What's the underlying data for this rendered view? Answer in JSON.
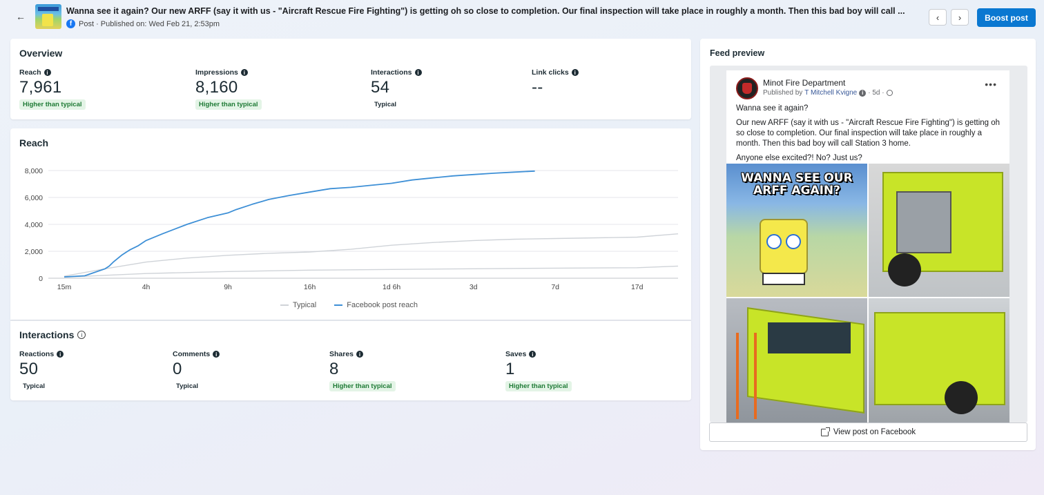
{
  "header": {
    "back_icon": "arrow-left-icon",
    "post_title": "Wanna see it again? Our new ARFF (say it with us - \"Aircraft Rescue Fire Fighting\") is getting oh so close to completion. Our final inspection will take place in roughly a month. Then this bad boy will call ...",
    "meta": "Post · Published on: Wed Feb 21, 2:53pm",
    "prev_icon": "chevron-left-icon",
    "next_icon": "chevron-right-icon",
    "boost_label": "Boost post",
    "boost_color": "#0a78d1"
  },
  "overview": {
    "title": "Overview",
    "metrics": [
      {
        "label": "Reach",
        "value": "7,961",
        "badge": "Higher than typical",
        "badge_type": "green"
      },
      {
        "label": "Impressions",
        "value": "8,160",
        "badge": "Higher than typical",
        "badge_type": "green"
      },
      {
        "label": "Interactions",
        "value": "54",
        "badge": "Typical",
        "badge_type": "plain"
      },
      {
        "label": "Link clicks",
        "value": "--",
        "badge": "",
        "badge_type": "none"
      }
    ]
  },
  "reach": {
    "title": "Reach",
    "legend": [
      "Typical",
      "Facebook post reach"
    ]
  },
  "chart_data": {
    "type": "line",
    "title": "Reach",
    "xlabel": "",
    "ylabel": "",
    "x_ticks": [
      "15m",
      "4h",
      "9h",
      "16h",
      "1d 6h",
      "3d",
      "7d",
      "17d"
    ],
    "y_ticks": [
      "0",
      "2,000",
      "4,000",
      "6,000",
      "8,000"
    ],
    "ylim": [
      0,
      8000
    ],
    "grid": true,
    "legend_position": "bottom",
    "series": [
      {
        "name": "Facebook post reach",
        "color": "#3d8fd6",
        "x": [
          0,
          0.25,
          0.5,
          0.55,
          0.6,
          0.7,
          0.75,
          0.8,
          0.9,
          1,
          1.2,
          1.5,
          1.75,
          2,
          2.1,
          2.3,
          2.5,
          2.75,
          3,
          3.25,
          3.5,
          3.75,
          4,
          4.25,
          4.5,
          4.75,
          5,
          5.25,
          5.5,
          5.75
        ],
        "values": [
          100,
          180,
          700,
          900,
          1200,
          1700,
          1900,
          2100,
          2400,
          2800,
          3300,
          4000,
          4500,
          4850,
          5100,
          5500,
          5850,
          6150,
          6400,
          6650,
          6750,
          6900,
          7050,
          7300,
          7450,
          7600,
          7700,
          7800,
          7880,
          7961
        ]
      },
      {
        "name": "Typical",
        "color": "#cfd3d8",
        "x": [
          0,
          0.5,
          1,
          1.5,
          2,
          2.5,
          3,
          3.5,
          4,
          4.5,
          5,
          5.5,
          6,
          6.5,
          7,
          7.5
        ],
        "values": [
          150,
          700,
          1200,
          1500,
          1700,
          1850,
          1950,
          2150,
          2450,
          2650,
          2800,
          2900,
          2950,
          3000,
          3050,
          3300
        ]
      },
      {
        "name": "Typical (lower band)",
        "color": "#cfd3d8",
        "x": [
          0,
          1,
          2,
          3,
          4,
          5,
          6,
          7,
          7.5
        ],
        "values": [
          80,
          350,
          500,
          600,
          650,
          700,
          750,
          780,
          900
        ]
      }
    ]
  },
  "interactions": {
    "title": "Interactions",
    "info_icon": "info-circle-icon",
    "metrics": [
      {
        "label": "Reactions",
        "value": "50",
        "badge": "Typical",
        "badge_type": "plain"
      },
      {
        "label": "Comments",
        "value": "0",
        "badge": "Typical",
        "badge_type": "plain"
      },
      {
        "label": "Shares",
        "value": "8",
        "badge": "Higher than typical",
        "badge_type": "green"
      },
      {
        "label": "Saves",
        "value": "1",
        "badge": "Higher than typical",
        "badge_type": "green"
      }
    ]
  },
  "feed_preview": {
    "title": "Feed preview",
    "page_name": "Minot Fire Department",
    "published_by_prefix": "Published by",
    "author": "T Mitchell Kvigne",
    "age": "· 5d ·",
    "more_icon": "more-horizontal-icon",
    "globe_icon": "globe-icon",
    "text": [
      "Wanna see it again?",
      "Our new ARFF (say it with us - \"Aircraft Rescue Fire Fighting\") is getting oh so close to completion. Our final inspection will take place in roughly a month. Then this bad boy will call Station 3 home.",
      "Anyone else excited?! No? Just us?"
    ],
    "meme_caption": "WANNA SEE OUR ARFF AGAIN?",
    "view_label": "View post on Facebook",
    "view_icon": "external-link-icon"
  }
}
